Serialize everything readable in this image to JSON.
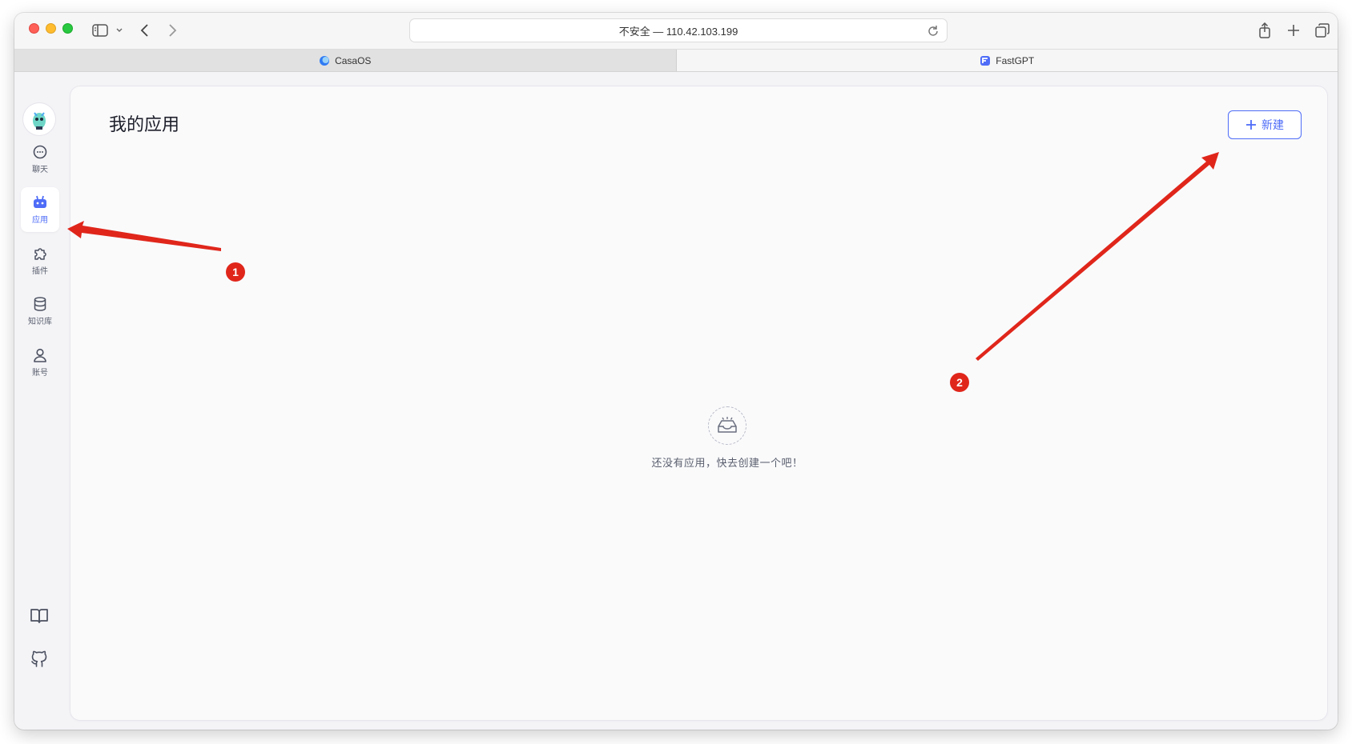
{
  "browser": {
    "url": "不安全 — 110.42.103.199",
    "tabs": [
      {
        "label": "CasaOS",
        "active": false
      },
      {
        "label": "FastGPT",
        "active": true
      }
    ]
  },
  "sidebar": {
    "items": [
      {
        "label": "聊天",
        "icon": "chat-icon",
        "active": false
      },
      {
        "label": "应用",
        "icon": "robot-icon",
        "active": true
      },
      {
        "label": "插件",
        "icon": "puzzle-icon",
        "active": false
      },
      {
        "label": "知识库",
        "icon": "database-icon",
        "active": false
      },
      {
        "label": "账号",
        "icon": "user-icon",
        "active": false
      }
    ],
    "bottom": [
      {
        "icon": "book-icon"
      },
      {
        "icon": "github-icon"
      }
    ]
  },
  "main": {
    "title": "我的应用",
    "new_button": "新建",
    "empty_text": "还没有应用，快去创建一个吧！"
  },
  "annotations": {
    "badge_1": "1",
    "badge_2": "2",
    "color": "#e0261b"
  },
  "colors": {
    "accent": "#4e6cf7",
    "annotation": "#e0261b"
  }
}
